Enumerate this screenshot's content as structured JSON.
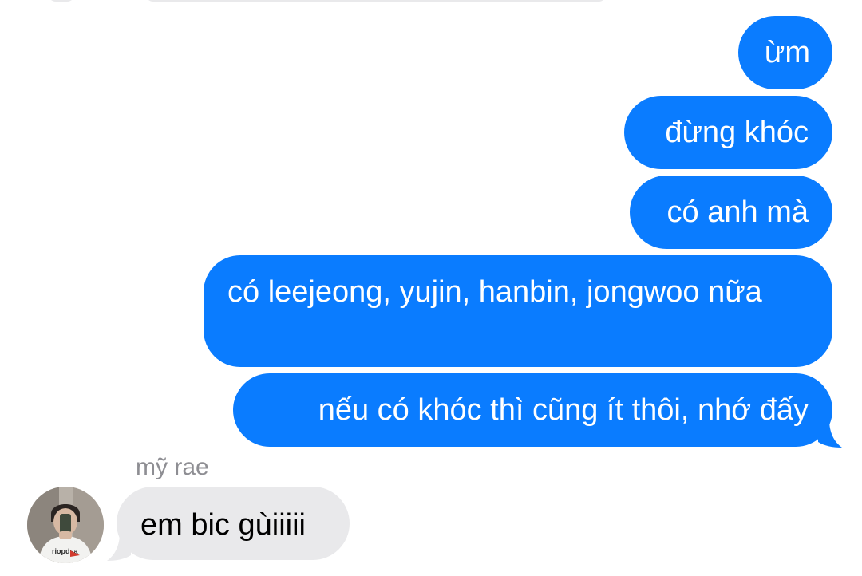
{
  "conversation": {
    "outgoing": [
      "ừm",
      "đừng khóc",
      "có anh mà",
      "có leejeong, yujin, hanbin, jongwoo nữa",
      "nếu có khóc thì cũng ít thôi, nhớ đấy"
    ],
    "incoming": {
      "sender_name": "mỹ rae",
      "messages": [
        "em bic gùiiiii"
      ],
      "avatar_icon": "profile-photo-avatar"
    }
  },
  "colors": {
    "outgoing_bubble": "#0a7cff",
    "incoming_bubble": "#e9e9eb",
    "sender_name": "#8e8e93",
    "background": "#ffffff"
  }
}
